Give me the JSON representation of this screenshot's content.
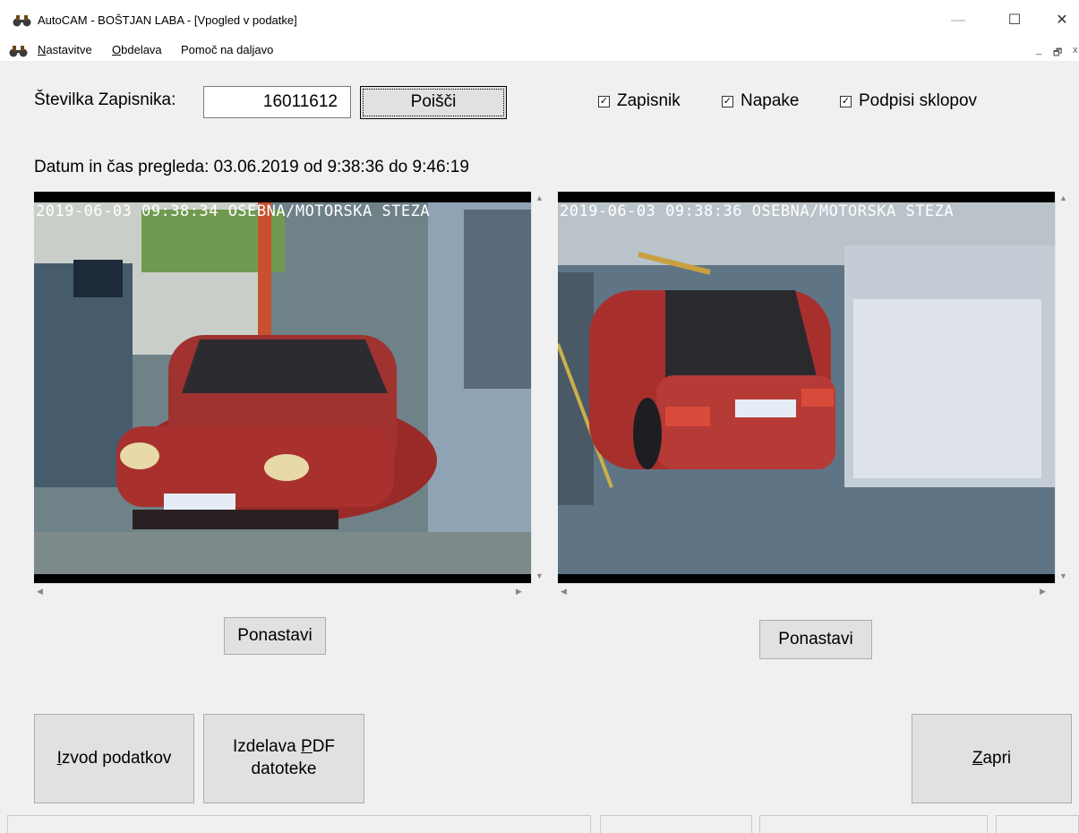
{
  "window": {
    "title": "AutoCAM - BOŠTJAN LABA - [Vpogled v podatke]",
    "minimize": "—",
    "maximize": "☐",
    "close": "✕"
  },
  "menu": {
    "items": [
      "Nastavitve",
      "Obdelava",
      "Pomoč na daljavo"
    ],
    "mnemonics": [
      "N",
      "O",
      ""
    ],
    "rests": [
      "astavitve",
      "bdelava",
      "Pomoč na daljavo"
    ],
    "mdi_minimize": "_",
    "mdi_restore": "🗗",
    "mdi_close": "x"
  },
  "search": {
    "label": "Številka Zapisnika:",
    "value": "16011612",
    "button": "Poišči"
  },
  "checkboxes": [
    {
      "label": "Zapisnik",
      "checked": true
    },
    {
      "label": "Napake",
      "checked": true
    },
    {
      "label": "Podpisi sklopov",
      "checked": true
    }
  ],
  "inspection": {
    "text": "Datum in čas pregleda: 03.06.2019 od  9:38:36 do  9:46:19"
  },
  "images": [
    {
      "stamp": "2019-06-03 09:38:34 OSEBNA/MOTORSKA STEZA",
      "reset": "Ponastavi"
    },
    {
      "stamp": "2019-06-03 09:38:36 OSEBNA/MOTORSKA STEZA",
      "reset": "Ponastavi"
    }
  ],
  "actions": {
    "export_pre": "I",
    "export_rest": "zvod podatkov",
    "pdf_line1_pre": "Izdelava ",
    "pdf_line1_u": "P",
    "pdf_line1_rest": "DF",
    "pdf_line2": "datoteke",
    "close_u": "Z",
    "close_rest": "apri"
  }
}
